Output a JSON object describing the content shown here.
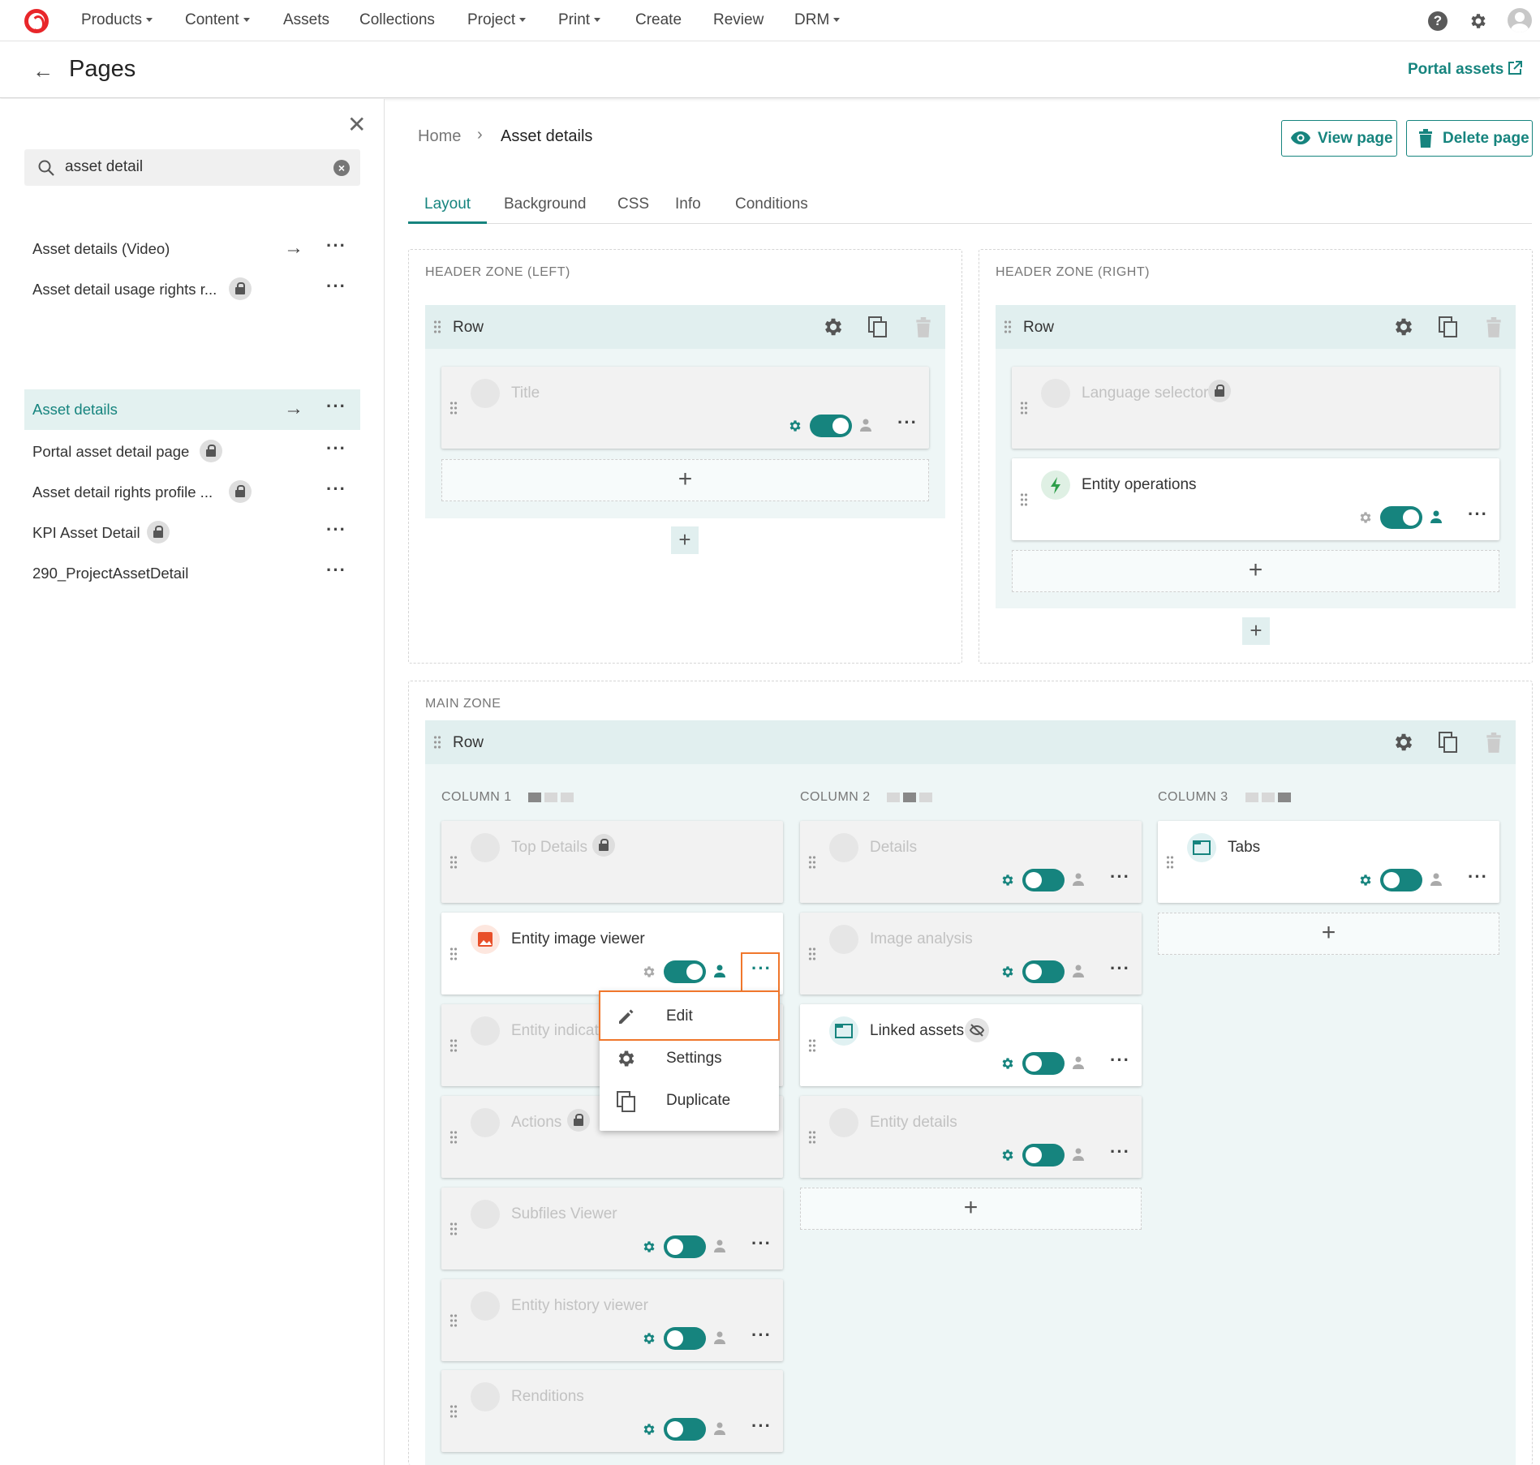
{
  "nav": {
    "items": [
      {
        "label": "Products",
        "dropdown": true
      },
      {
        "label": "Content",
        "dropdown": true
      },
      {
        "label": "Assets",
        "dropdown": false
      },
      {
        "label": "Collections",
        "dropdown": false
      },
      {
        "label": "Project",
        "dropdown": true
      },
      {
        "label": "Print",
        "dropdown": true
      },
      {
        "label": "Create",
        "dropdown": false
      },
      {
        "label": "Review",
        "dropdown": false
      },
      {
        "label": "DRM",
        "dropdown": true
      }
    ],
    "help_glyph": "?"
  },
  "header": {
    "title": "Pages",
    "portal_link": "Portal assets"
  },
  "sidebar": {
    "search_value": "asset detail",
    "items": [
      {
        "label": "Asset details (Video)",
        "locked": false,
        "arrow": true,
        "active": false
      },
      {
        "label": "Asset detail usage rights r...",
        "locked": true,
        "arrow": false,
        "active": false
      },
      {
        "label": "Asset details",
        "locked": false,
        "arrow": true,
        "active": true
      },
      {
        "label": "Portal asset detail page",
        "locked": true,
        "arrow": false,
        "active": false
      },
      {
        "label": "Asset detail rights profile ...",
        "locked": true,
        "arrow": false,
        "active": false
      },
      {
        "label": "KPI Asset Detail",
        "locked": true,
        "arrow": false,
        "active": false
      },
      {
        "label": "290_ProjectAssetDetail",
        "locked": false,
        "arrow": false,
        "active": false
      }
    ]
  },
  "breadcrumb": {
    "home": "Home",
    "current": "Asset details"
  },
  "actions": {
    "view_page": "View page",
    "delete_page": "Delete page"
  },
  "tabs": [
    "Layout",
    "Background",
    "CSS",
    "Info",
    "Conditions"
  ],
  "active_tab": "Layout",
  "zones": {
    "header_left": {
      "label": "HEADER ZONE (LEFT)",
      "row_label": "Row",
      "cards": [
        {
          "title": "Title",
          "disabled": true,
          "toggle_on": true
        }
      ]
    },
    "header_right": {
      "label": "HEADER ZONE (RIGHT)",
      "row_label": "Row",
      "cards": [
        {
          "title": "Language selector",
          "disabled": true,
          "locked": true
        },
        {
          "title": "Entity operations",
          "disabled": false,
          "toggle_on": true
        }
      ]
    },
    "main": {
      "label": "MAIN ZONE",
      "row_label": "Row",
      "columns": [
        {
          "label": "COLUMN 1",
          "cards": [
            {
              "title": "Top Details",
              "disabled": true,
              "locked": true
            },
            {
              "title": "Entity image viewer",
              "disabled": false,
              "toggle_on": true
            },
            {
              "title": "Entity indicat",
              "disabled": true
            },
            {
              "title": "Actions",
              "disabled": true,
              "locked": true
            },
            {
              "title": "Subfiles Viewer",
              "disabled": true,
              "toggle_on": false
            },
            {
              "title": "Entity history viewer",
              "disabled": true,
              "toggle_on": false
            },
            {
              "title": "Renditions",
              "disabled": true,
              "toggle_on": false
            }
          ]
        },
        {
          "label": "COLUMN 2",
          "cards": [
            {
              "title": "Details",
              "disabled": true,
              "toggle_on": false
            },
            {
              "title": "Image analysis",
              "disabled": true,
              "toggle_on": false
            },
            {
              "title": "Linked assets",
              "disabled": false,
              "toggle_on": false
            },
            {
              "title": "Entity details",
              "disabled": true,
              "toggle_on": false
            }
          ]
        },
        {
          "label": "COLUMN 3",
          "cards": [
            {
              "title": "Tabs",
              "disabled": false,
              "toggle_on": false
            }
          ]
        }
      ]
    }
  },
  "context_menu": {
    "items": [
      {
        "label": "Edit",
        "icon": "pencil-icon"
      },
      {
        "label": "Settings",
        "icon": "gear-icon"
      },
      {
        "label": "Duplicate",
        "icon": "copy-icon"
      }
    ]
  },
  "colors": {
    "accent": "#16847e",
    "brand": "#e8262a",
    "highlight": "#f0772c"
  }
}
